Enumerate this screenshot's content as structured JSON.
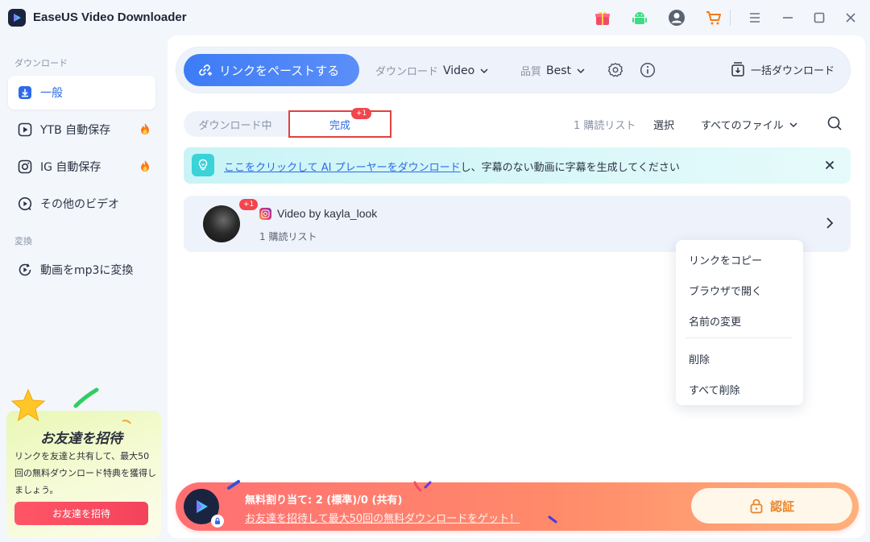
{
  "window": {
    "title": "EaseUS Video Downloader",
    "icons": [
      "gift-icon",
      "android-icon",
      "account-icon",
      "cart-icon",
      "menu-icon",
      "minimize-icon",
      "maximize-icon",
      "close-icon"
    ]
  },
  "sidebar": {
    "section_download": "ダウンロード",
    "items": [
      {
        "label": "一般",
        "icon": "download-icon",
        "active": true
      },
      {
        "label": "YTB 自動保存",
        "icon": "youtube-icon",
        "hot": true
      },
      {
        "label": "IG 自動保存",
        "icon": "instagram-icon",
        "hot": true
      },
      {
        "label": "その他のビデオ",
        "icon": "video-icon"
      }
    ],
    "section_convert": "変換",
    "convert_items": [
      {
        "label": "動画をmp3に変換",
        "icon": "convert-icon"
      }
    ],
    "invite": {
      "title": "お友達を招待",
      "text": "リンクを友達と共有して、最大50回の無料ダウンロード特典を獲得しましょう。",
      "button": "お友達を招待"
    }
  },
  "toolbar": {
    "paste_label": "リンクをペーストする",
    "download_label": "ダウンロード",
    "download_value": "Video",
    "quality_label": "品質",
    "quality_value": "Best",
    "batch_label": "一括ダウンロード"
  },
  "tabs": {
    "downloading": "ダウンロード中",
    "completed": "完成",
    "badge": "+1"
  },
  "filters": {
    "list_count": "1 購読リスト",
    "select": "選択",
    "all_files": "すべてのファイル"
  },
  "banner": {
    "link": "ここをクリックして AI プレーヤーをダウンロード",
    "rest": "し、字幕のない動画に字幕を生成してください"
  },
  "item": {
    "badge": "+1",
    "title": "Video by kayla_look",
    "subtitle": "1 購読リスト"
  },
  "context_menu": {
    "copy_link": "リンクをコピー",
    "open_browser": "ブラウザで開く",
    "rename": "名前の変更",
    "delete": "削除",
    "delete_all": "すべて削除"
  },
  "quota": {
    "text": "無料割り当て: 2 (標準)/0 (共有)",
    "link": "お友達を招待して最大50回の無料ダウンロードをゲット！",
    "verify": "認証"
  },
  "colors": {
    "accent": "#2f6ae8",
    "badge": "#f2454d",
    "quota_start": "#ff6f72",
    "quota_end": "#ffb07a",
    "verify_text": "#e8862d"
  }
}
